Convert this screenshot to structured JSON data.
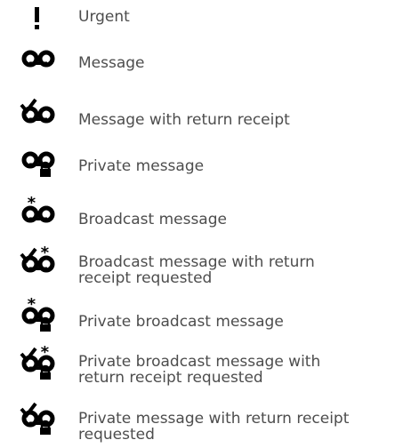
{
  "legend": {
    "items": [
      {
        "label": "Urgent",
        "icon": "exclamation-icon"
      },
      {
        "label": "Message",
        "icon": "voicemail-tape-icon"
      },
      {
        "label": "Message with return receipt",
        "icon": "tape-checkmark-icon"
      },
      {
        "label": "Private message",
        "icon": "tape-lock-icon"
      },
      {
        "label": "Broadcast message",
        "icon": "tape-star-icon"
      },
      {
        "label": "Broadcast message with return receipt requested",
        "icon": "tape-checkmark-star-icon"
      },
      {
        "label": "Private broadcast message",
        "icon": "tape-star-lock-icon"
      },
      {
        "label": "Private broadcast message with return receipt requested",
        "icon": "tape-checkmark-star-lock-icon"
      },
      {
        "label": "Private message with return receipt requested",
        "icon": "tape-checkmark-lock-icon"
      }
    ]
  }
}
